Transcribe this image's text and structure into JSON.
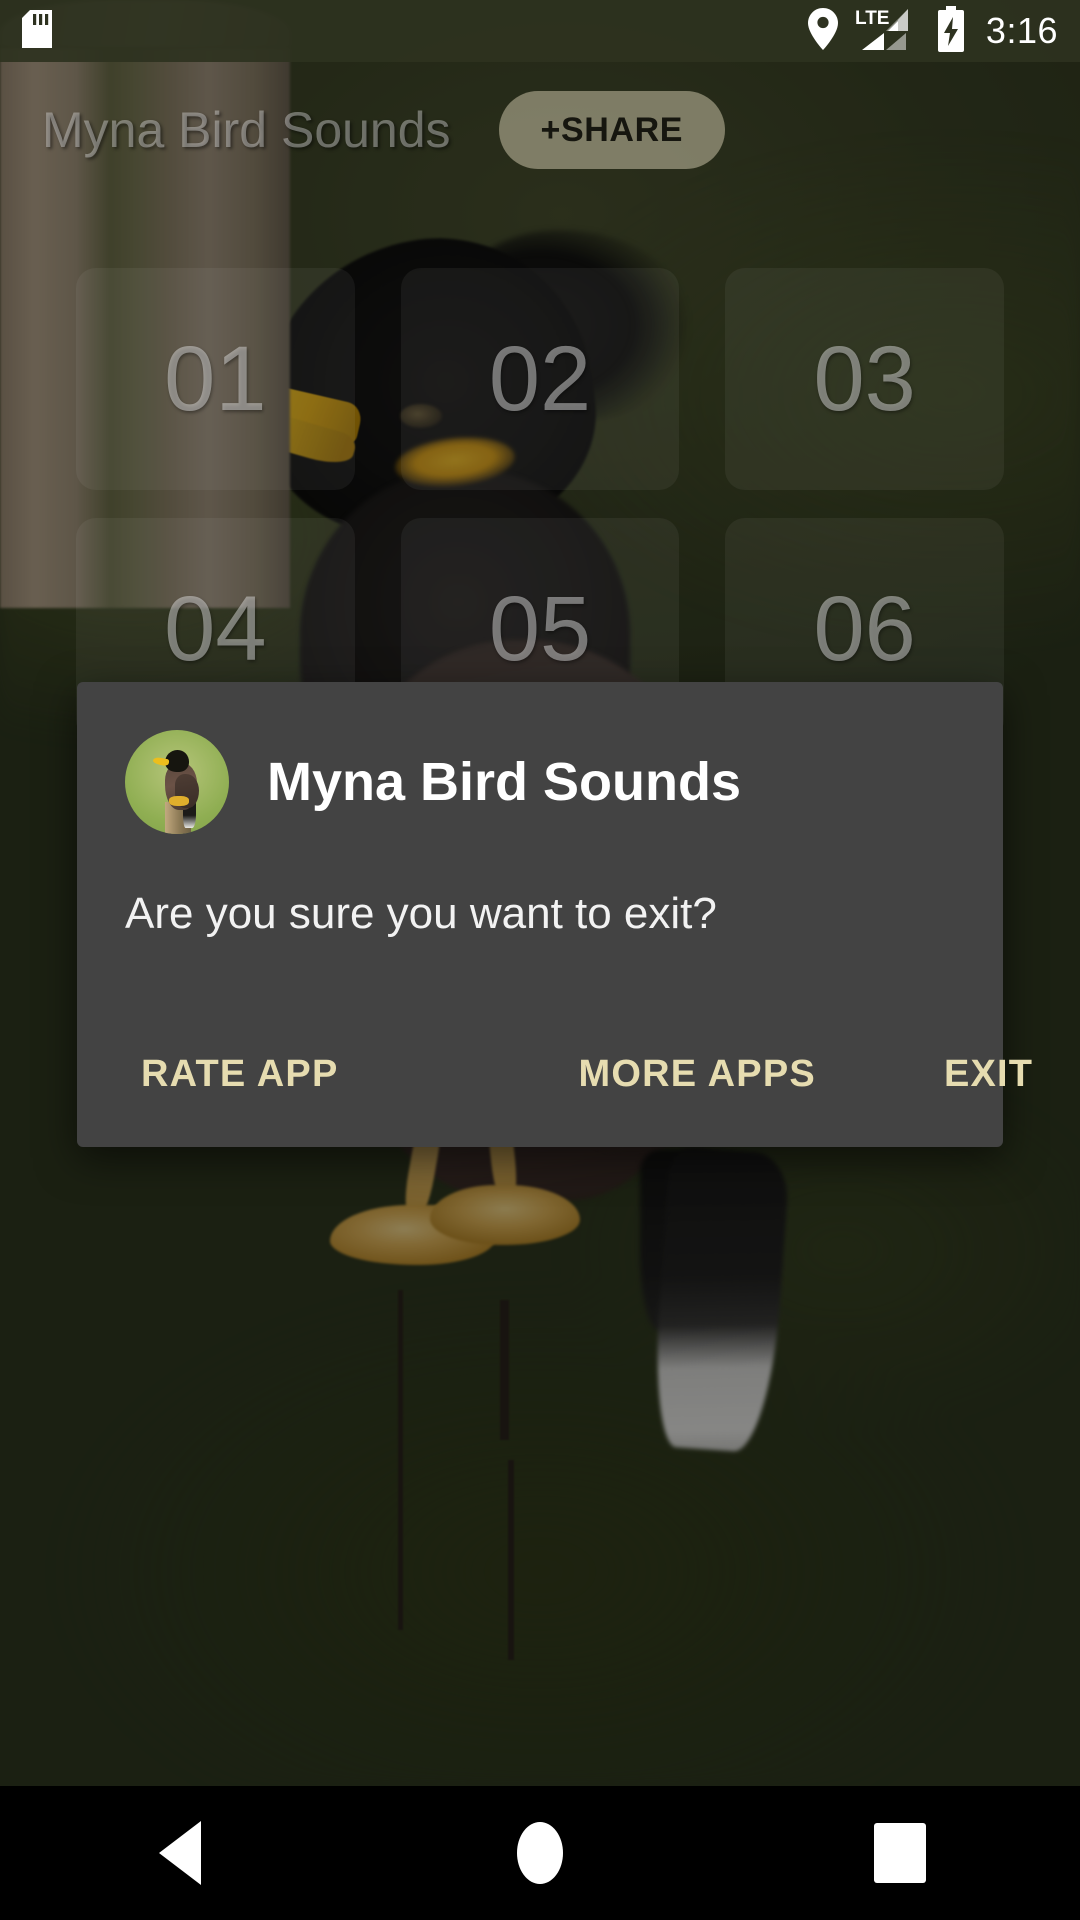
{
  "status_bar": {
    "sd_card_icon": "sd-card-icon",
    "location_icon": "location-pin-icon",
    "network_label": "LTE",
    "signal_icon": "signal-bars-icon",
    "battery_icon": "battery-charging-icon",
    "time": "3:16"
  },
  "toolbar": {
    "title": "Myna Bird Sounds",
    "share_label": "+SHARE"
  },
  "grid": {
    "tiles": [
      {
        "label": "01"
      },
      {
        "label": "02"
      },
      {
        "label": "03"
      },
      {
        "label": "04"
      },
      {
        "label": "05"
      },
      {
        "label": "06"
      }
    ]
  },
  "dialog": {
    "app_icon": "myna-bird-app-icon",
    "title": "Myna Bird Sounds",
    "message": "Are you sure you want to exit?",
    "buttons": {
      "rate_app": "RATE APP",
      "more_apps": "MORE APPS",
      "exit": "EXIT"
    }
  },
  "navigation_bar": {
    "back": "back-icon",
    "home": "home-icon",
    "recents": "recents-icon"
  },
  "colors": {
    "dialog_background": "#434343",
    "dialog_button_text": "#e6dcb0",
    "status_bar_background": "#2e3220",
    "navigation_bar_background": "#000000",
    "app_background_tint": "#3e4526"
  }
}
